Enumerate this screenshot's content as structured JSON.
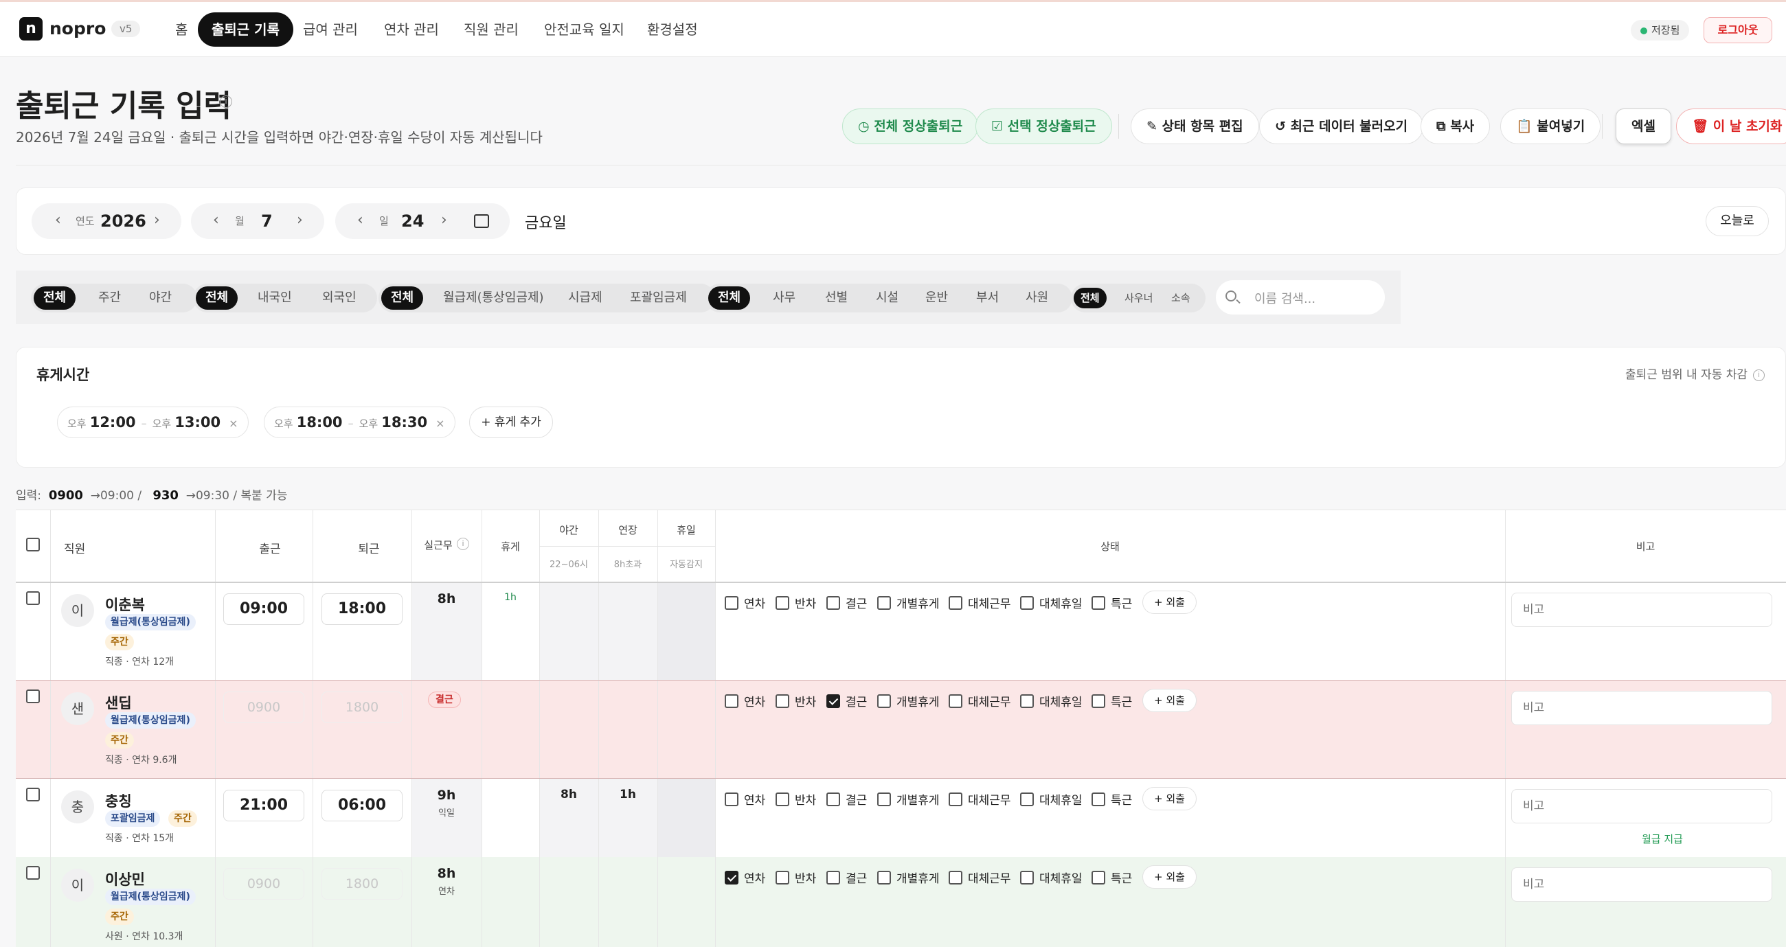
{
  "nav": {
    "brand_mark": "n",
    "brand": "nopro",
    "version": "v5",
    "items": [
      {
        "label": "홈"
      },
      {
        "label": "출퇴근 기록",
        "active": true
      },
      {
        "label": "급여 관리"
      },
      {
        "label": "연차 관리"
      },
      {
        "label": "직원 관리"
      },
      {
        "label": "안전교육 일지"
      },
      {
        "label": "환경설정"
      }
    ],
    "saved": "저장됨",
    "logout": "로그아웃"
  },
  "page": {
    "title": "출퇴근 기록 입력",
    "subtitle": "2026년 7월 24일 금요일 · 출퇴근 시간을 입력하면 야간·연장·휴일 수당이 자동 계산됩니다"
  },
  "actions": {
    "all_normal": "전체 정상출퇴근",
    "selected_normal": "선택 정상출퇴근",
    "edit_status": "상태 항목 편집",
    "load_recent": "최근 데이터 불러오기",
    "copy": "복사",
    "paste": "붙여넣기",
    "excel": "엑셀",
    "reset_day": "이 날 초기화"
  },
  "date": {
    "year_label": "연도",
    "year": "2026",
    "month_label": "월",
    "month": "7",
    "day_label": "일",
    "day": "24",
    "weekday": "금요일",
    "today": "오늘로"
  },
  "filters": {
    "shift": [
      "전체",
      "주간",
      "야간"
    ],
    "nationality": [
      "전체",
      "내국인",
      "외국인"
    ],
    "pay_type": [
      "전체",
      "월급제(통상임금제)",
      "시급제",
      "포괄임금제"
    ],
    "job": [
      "전체",
      "사무",
      "선별",
      "시설",
      "운반",
      "부서",
      "사원"
    ],
    "rank": [
      "전체",
      "사우너",
      "소속"
    ],
    "search_placeholder": "이름 검색..."
  },
  "breaks": {
    "title": "휴게시간",
    "auto_note": "출퇴근 범위 내 자동 차감",
    "items": [
      {
        "start_ap": "오후",
        "start": "12:00",
        "end_ap": "오후",
        "end": "13:00"
      },
      {
        "start_ap": "오후",
        "start": "18:00",
        "end_ap": "오후",
        "end": "18:30"
      }
    ],
    "add": "+ 휴게 추가"
  },
  "input_hint": {
    "label": "입력:",
    "ex1": "0900",
    "ex1_result": "→09:00 /",
    "ex2": "930",
    "ex2_result": "→09:30 / 복붙 가능"
  },
  "table": {
    "headers": {
      "employee": "직원",
      "in": "출근",
      "out": "퇴근",
      "actual": "실근무",
      "break": "휴게",
      "night": "야간",
      "night_sub": "22~06시",
      "overtime": "연장",
      "overtime_sub": "8h초과",
      "holiday": "휴일",
      "holiday_sub": "자동감지",
      "status": "상태",
      "memo": "비고"
    },
    "status_labels": [
      "연차",
      "반차",
      "결근",
      "개별휴게",
      "대체근무",
      "대체휴일",
      "특근"
    ],
    "outing": "+ 외출",
    "memo_placeholder": "비고",
    "rows": [
      {
        "avatar": "이",
        "name": "이춘복",
        "tags": [
          "월급제(통상임금제)",
          "주간"
        ],
        "meta": "직종 · 연차 12개",
        "in": "09:00",
        "out": "18:00",
        "in_disabled": false,
        "actual": "8h",
        "actual_sub": "",
        "brk": "1h",
        "night": "",
        "overtime": "",
        "absent_badge": "",
        "checked": [],
        "note": ""
      },
      {
        "avatar": "샌",
        "name": "샌딥",
        "tags": [
          "월급제(통상임금제)",
          "주간"
        ],
        "meta": "직종 · 연차 9.6개",
        "in": "0900",
        "out": "1800",
        "in_disabled": true,
        "actual": "",
        "actual_sub": "",
        "brk": "",
        "night": "",
        "overtime": "",
        "absent_badge": "결근",
        "checked": [
          "결근"
        ],
        "note": ""
      },
      {
        "avatar": "충",
        "name": "충칭",
        "tags": [
          "포괄임금제",
          "주간"
        ],
        "meta": "직종 · 연차 15개",
        "in": "21:00",
        "out": "06:00",
        "in_disabled": false,
        "actual": "9h",
        "actual_sub": "익일",
        "brk": "",
        "night": "8h",
        "overtime": "1h",
        "absent_badge": "",
        "checked": [],
        "note": "월급 지급"
      },
      {
        "avatar": "이",
        "name": "이상민",
        "tags": [
          "월급제(통상임금제)",
          "주간"
        ],
        "meta": "사원 · 연차 10.3개",
        "in": "0900",
        "out": "1800",
        "in_disabled": true,
        "actual": "8h",
        "actual_sub": "연차",
        "brk": "",
        "night": "",
        "overtime": "",
        "absent_badge": "",
        "checked": [
          "연차"
        ],
        "note": ""
      }
    ]
  },
  "colors": {
    "accent": "#111111",
    "danger": "#d22222",
    "success": "#1f8a4c",
    "absent_row": "#fbe7e7",
    "leave_row": "#eef6ee"
  }
}
